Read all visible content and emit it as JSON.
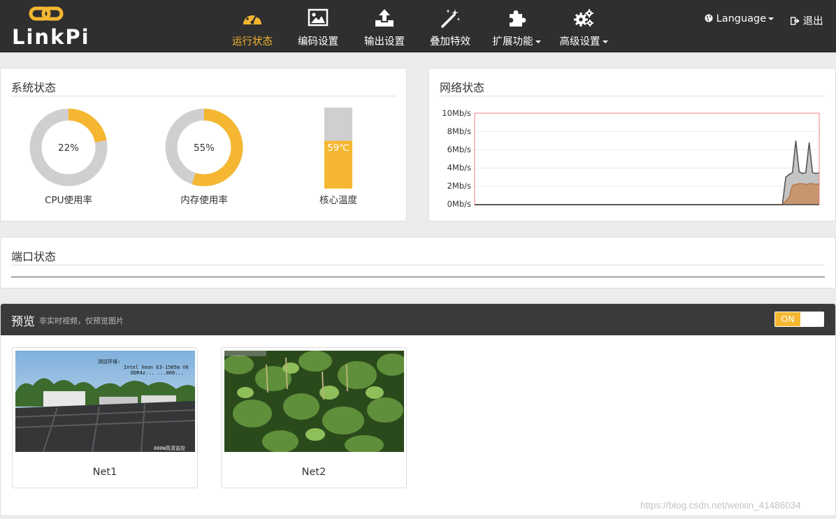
{
  "brand": {
    "logo_text": "LinkPi"
  },
  "nav": {
    "items": [
      {
        "label": "运行状态",
        "icon": "dashboard-icon",
        "active": true
      },
      {
        "label": "编码设置",
        "icon": "picture-icon",
        "active": false
      },
      {
        "label": "输出设置",
        "icon": "upload-icon",
        "active": false
      },
      {
        "label": "叠加特效",
        "icon": "magic-wand-icon",
        "active": false
      },
      {
        "label": "扩展功能",
        "icon": "puzzle-icon",
        "active": false,
        "dropdown": true
      },
      {
        "label": "高级设置",
        "icon": "gears-icon",
        "active": false,
        "dropdown": true
      }
    ],
    "language": "Language",
    "logout": "退出"
  },
  "system_status": {
    "title": "系统状态",
    "cpu": {
      "label": "CPU使用率",
      "value_text": "22%",
      "fraction": 0.22
    },
    "memory": {
      "label": "内存使用率",
      "value_text": "55%",
      "fraction": 0.55
    },
    "temperature": {
      "label": "核心温度",
      "value_text": "59℃",
      "fraction": 0.59
    }
  },
  "network_status": {
    "title": "网络状态",
    "chart_data": {
      "type": "area",
      "y_tick_labels": [
        "10Mb/s",
        "8Mb/s",
        "6Mb/s",
        "4Mb/s",
        "2Mb/s",
        "0Mb/s"
      ],
      "ylim": [
        0,
        10
      ],
      "series": [
        {
          "color": "#555555",
          "fill": "#c4c4c4",
          "values": [
            0,
            0,
            0,
            0,
            0,
            0,
            0,
            0,
            0,
            0,
            0,
            0,
            0,
            0,
            0,
            0,
            0,
            0,
            0,
            0,
            0,
            0,
            0,
            0,
            0,
            0,
            0,
            0,
            0,
            0,
            0,
            0,
            0,
            0,
            0,
            0,
            0,
            0,
            0,
            0,
            0,
            0,
            0,
            0,
            0,
            0,
            0,
            0,
            0,
            0,
            0,
            0,
            0,
            0,
            0,
            0,
            0,
            0,
            0,
            0,
            0,
            0,
            0,
            0,
            0,
            0,
            0,
            0,
            0,
            0,
            0,
            0,
            0,
            0,
            0,
            0,
            0,
            0,
            0,
            0,
            0,
            0,
            0,
            0,
            0,
            0,
            0,
            0,
            0,
            0,
            0,
            0,
            0,
            3.0,
            3.3,
            3.5,
            7.0,
            3.6,
            3.4,
            3.5,
            6.8,
            3.5,
            3.4,
            3.5
          ]
        },
        {
          "color": "#b87a4b",
          "fill": "#c69670",
          "values": [
            0,
            0,
            0,
            0,
            0,
            0,
            0,
            0,
            0,
            0,
            0,
            0,
            0,
            0,
            0,
            0,
            0,
            0,
            0,
            0,
            0,
            0,
            0,
            0,
            0,
            0,
            0,
            0,
            0,
            0,
            0,
            0,
            0,
            0,
            0,
            0,
            0,
            0,
            0,
            0,
            0,
            0,
            0,
            0,
            0,
            0,
            0,
            0,
            0,
            0,
            0,
            0,
            0,
            0,
            0,
            0,
            0,
            0,
            0,
            0,
            0,
            0,
            0,
            0,
            0,
            0,
            0,
            0,
            0,
            0,
            0,
            0,
            0,
            0,
            0,
            0,
            0,
            0,
            0,
            0,
            0,
            0,
            0,
            0,
            0,
            0,
            0,
            0,
            0,
            0,
            0,
            0,
            0,
            0.4,
            0.8,
            2.1,
            2.2,
            2.3,
            2.3,
            2.2,
            2.3,
            2.3,
            2.2,
            2.3
          ]
        }
      ],
      "border_color": "#f08080"
    }
  },
  "port_status": {
    "title": "端口状态"
  },
  "preview": {
    "title": "预览",
    "subtitle": "非实时视频，仅预览图片",
    "toggle_label": "ON",
    "thumbnails": [
      {
        "label": "Net1",
        "overlay_lines": [
          "测试环境:",
          "Intel Xeon E3-1505m V6",
          "DDR4z... ...000..."
        ],
        "corner_text": "800W高清监控"
      },
      {
        "label": "Net2",
        "overlay_lines": [],
        "corner_text": ""
      }
    ]
  },
  "watermark": "https://blog.csdn.net/weixin_41486034"
}
